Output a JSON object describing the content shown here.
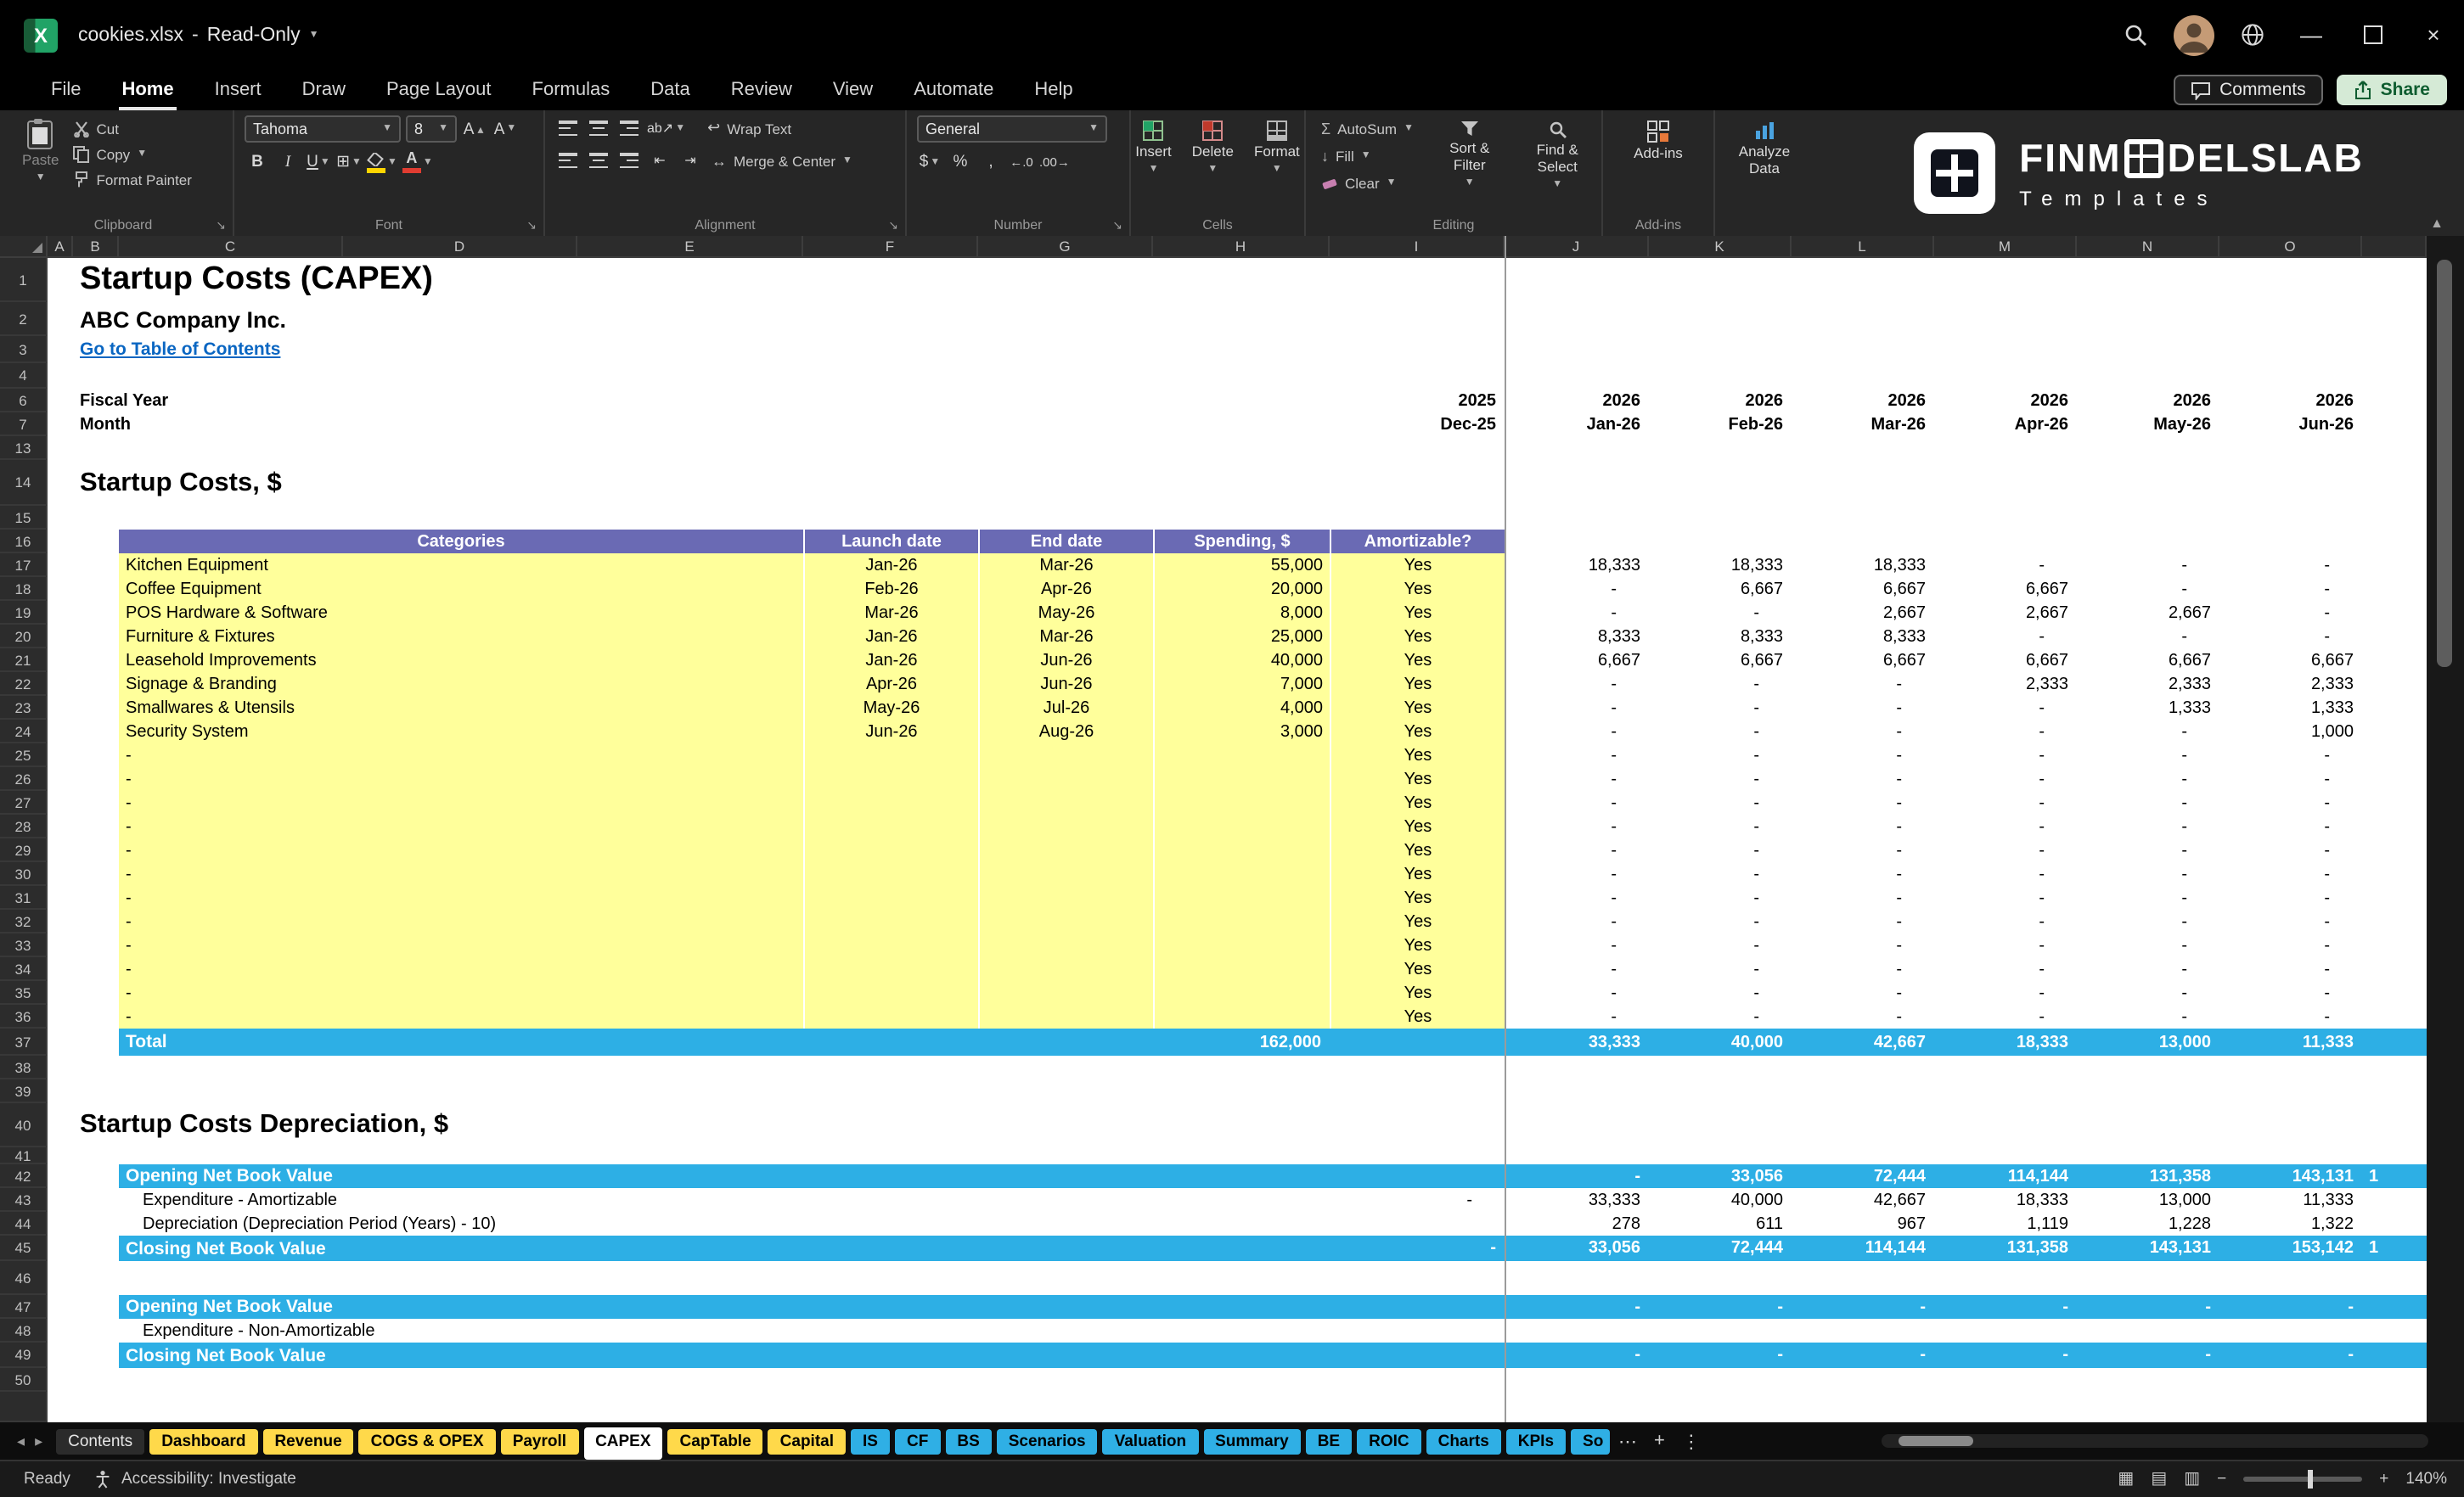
{
  "titlebar": {
    "filename": "cookies.xlsx",
    "separator": "-",
    "mode": "Read-Only"
  },
  "menu": {
    "items": [
      "File",
      "Home",
      "Insert",
      "Draw",
      "Page Layout",
      "Formulas",
      "Data",
      "Review",
      "View",
      "Automate",
      "Help"
    ],
    "active": "Home",
    "comments": "Comments",
    "share": "Share"
  },
  "ribbon": {
    "clipboard": {
      "group": "Clipboard",
      "paste": "Paste",
      "cut": "Cut",
      "copy": "Copy",
      "format_painter": "Format Painter"
    },
    "font": {
      "group": "Font",
      "family": "Tahoma",
      "size": "8"
    },
    "alignment": {
      "group": "Alignment",
      "wrap_text": "Wrap Text",
      "merge_center": "Merge & Center"
    },
    "number": {
      "group": "Number",
      "format": "General"
    },
    "cells": {
      "group": "Cells",
      "insert": "Insert",
      "delete": "Delete",
      "format": "Format"
    },
    "editing": {
      "group": "Editing",
      "autosum": "AutoSum",
      "fill": "Fill",
      "clear": "Clear",
      "sort_filter": "Sort & Filter",
      "find_select": "Find & Select"
    },
    "addins": {
      "group": "Add-ins",
      "addins": "Add-ins",
      "analyze": "Analyze Data"
    }
  },
  "brand": {
    "pre": "FINM",
    "post": "DELSLAB",
    "tagline": "Templates"
  },
  "sheet": {
    "col_letters": [
      "A",
      "B",
      "C",
      "D",
      "E",
      "F",
      "G",
      "H",
      "I",
      "J",
      "K",
      "L",
      "M",
      "N",
      "O"
    ],
    "title": "Startup Costs (CAPEX)",
    "company": "ABC Company Inc.",
    "toc": "Go to Table of Contents",
    "fiscal_year_label": "Fiscal Year",
    "month_label": "Month",
    "years": [
      "2025",
      "2026",
      "2026",
      "2026",
      "2026",
      "2026",
      "2026"
    ],
    "month_headers": [
      "Dec-25",
      "Jan-26",
      "Feb-26",
      "Mar-26",
      "Apr-26",
      "May-26",
      "Jun-26"
    ],
    "section1": "Startup Costs, $",
    "thead": {
      "categories": "Categories",
      "launch": "Launch date",
      "end": "End date",
      "spending": "Spending, $",
      "amortizable": "Amortizable?"
    },
    "items": [
      {
        "name": "Kitchen Equipment",
        "launch": "Jan-26",
        "end": "Mar-26",
        "spending": "55,000",
        "amortizable": "Yes",
        "values": [
          "18,333",
          "18,333",
          "18,333",
          "-",
          "-",
          "-"
        ]
      },
      {
        "name": "Coffee Equipment",
        "launch": "Feb-26",
        "end": "Apr-26",
        "spending": "20,000",
        "amortizable": "Yes",
        "values": [
          "-",
          "6,667",
          "6,667",
          "6,667",
          "-",
          "-"
        ]
      },
      {
        "name": "POS Hardware & Software",
        "launch": "Mar-26",
        "end": "May-26",
        "spending": "8,000",
        "amortizable": "Yes",
        "values": [
          "-",
          "-",
          "2,667",
          "2,667",
          "2,667",
          "-"
        ]
      },
      {
        "name": "Furniture & Fixtures",
        "launch": "Jan-26",
        "end": "Mar-26",
        "spending": "25,000",
        "amortizable": "Yes",
        "values": [
          "8,333",
          "8,333",
          "8,333",
          "-",
          "-",
          "-"
        ]
      },
      {
        "name": "Leasehold Improvements",
        "launch": "Jan-26",
        "end": "Jun-26",
        "spending": "40,000",
        "amortizable": "Yes",
        "values": [
          "6,667",
          "6,667",
          "6,667",
          "6,667",
          "6,667",
          "6,667"
        ]
      },
      {
        "name": "Signage & Branding",
        "launch": "Apr-26",
        "end": "Jun-26",
        "spending": "7,000",
        "amortizable": "Yes",
        "values": [
          "-",
          "-",
          "-",
          "2,333",
          "2,333",
          "2,333"
        ]
      },
      {
        "name": "Smallwares & Utensils",
        "launch": "May-26",
        "end": "Jul-26",
        "spending": "4,000",
        "amortizable": "Yes",
        "values": [
          "-",
          "-",
          "-",
          "-",
          "1,333",
          "1,333"
        ]
      },
      {
        "name": "Security System",
        "launch": "Jun-26",
        "end": "Aug-26",
        "spending": "3,000",
        "amortizable": "Yes",
        "values": [
          "-",
          "-",
          "-",
          "-",
          "-",
          "1,000"
        ]
      },
      {
        "name": "-",
        "launch": "",
        "end": "",
        "spending": "",
        "amortizable": "Yes",
        "values": [
          "-",
          "-",
          "-",
          "-",
          "-",
          "-"
        ]
      },
      {
        "name": "-",
        "launch": "",
        "end": "",
        "spending": "",
        "amortizable": "Yes",
        "values": [
          "-",
          "-",
          "-",
          "-",
          "-",
          "-"
        ]
      },
      {
        "name": "-",
        "launch": "",
        "end": "",
        "spending": "",
        "amortizable": "Yes",
        "values": [
          "-",
          "-",
          "-",
          "-",
          "-",
          "-"
        ]
      },
      {
        "name": "-",
        "launch": "",
        "end": "",
        "spending": "",
        "amortizable": "Yes",
        "values": [
          "-",
          "-",
          "-",
          "-",
          "-",
          "-"
        ]
      },
      {
        "name": "-",
        "launch": "",
        "end": "",
        "spending": "",
        "amortizable": "Yes",
        "values": [
          "-",
          "-",
          "-",
          "-",
          "-",
          "-"
        ]
      },
      {
        "name": "-",
        "launch": "",
        "end": "",
        "spending": "",
        "amortizable": "Yes",
        "values": [
          "-",
          "-",
          "-",
          "-",
          "-",
          "-"
        ]
      },
      {
        "name": "-",
        "launch": "",
        "end": "",
        "spending": "",
        "amortizable": "Yes",
        "values": [
          "-",
          "-",
          "-",
          "-",
          "-",
          "-"
        ]
      },
      {
        "name": "-",
        "launch": "",
        "end": "",
        "spending": "",
        "amortizable": "Yes",
        "values": [
          "-",
          "-",
          "-",
          "-",
          "-",
          "-"
        ]
      },
      {
        "name": "-",
        "launch": "",
        "end": "",
        "spending": "",
        "amortizable": "Yes",
        "values": [
          "-",
          "-",
          "-",
          "-",
          "-",
          "-"
        ]
      },
      {
        "name": "-",
        "launch": "",
        "end": "",
        "spending": "",
        "amortizable": "Yes",
        "values": [
          "-",
          "-",
          "-",
          "-",
          "-",
          "-"
        ]
      },
      {
        "name": "-",
        "launch": "",
        "end": "",
        "spending": "",
        "amortizable": "Yes",
        "values": [
          "-",
          "-",
          "-",
          "-",
          "-",
          "-"
        ]
      },
      {
        "name": "-",
        "launch": "",
        "end": "",
        "spending": "",
        "amortizable": "Yes",
        "values": [
          "-",
          "-",
          "-",
          "-",
          "-",
          "-"
        ]
      }
    ],
    "total": {
      "label": "Total",
      "spending": "162,000",
      "values": [
        "33,333",
        "40,000",
        "42,667",
        "18,333",
        "13,000",
        "11,333"
      ]
    },
    "section2": "Startup Costs Depreciation, $",
    "depreciation": [
      {
        "label": "Opening Net Book Value",
        "style": "band",
        "col_i": "",
        "values": [
          "-",
          "33,056",
          "72,444",
          "114,144",
          "131,358",
          "143,131"
        ],
        "overflow": "1"
      },
      {
        "label": "Expenditure - Amortizable",
        "style": "plain",
        "col_i": "-",
        "values": [
          "33,333",
          "40,000",
          "42,667",
          "18,333",
          "13,000",
          "11,333"
        ],
        "overflow": ""
      },
      {
        "label": "Depreciation (Depreciation Period (Years) - 10)",
        "style": "plain",
        "col_i": "",
        "values": [
          "278",
          "611",
          "967",
          "1,119",
          "1,228",
          "1,322"
        ],
        "overflow": ""
      },
      {
        "label": "Closing Net Book Value",
        "style": "band",
        "col_i": "-",
        "values": [
          "33,056",
          "72,444",
          "114,144",
          "131,358",
          "143,131",
          "153,142"
        ],
        "overflow": "1"
      }
    ],
    "non_amortizable": [
      {
        "label": "Opening Net Book Value",
        "style": "band",
        "col_i": "",
        "values": [
          "-",
          "-",
          "-",
          "-",
          "-",
          "-"
        ],
        "overflow": ""
      },
      {
        "label": "Expenditure - Non-Amortizable",
        "style": "plain",
        "col_i": "",
        "values": [
          "",
          "",
          "",
          "",
          "",
          ""
        ],
        "overflow": ""
      },
      {
        "label": "Closing Net Book Value",
        "style": "band",
        "col_i": "",
        "values": [
          "-",
          "-",
          "-",
          "-",
          "-",
          "-"
        ],
        "overflow": ""
      }
    ]
  },
  "tabs": {
    "items": [
      {
        "label": "Contents",
        "color": "plain"
      },
      {
        "label": "Dashboard",
        "color": "yellow"
      },
      {
        "label": "Revenue",
        "color": "yellow"
      },
      {
        "label": "COGS & OPEX",
        "color": "yellow"
      },
      {
        "label": "Payroll",
        "color": "yellow"
      },
      {
        "label": "CAPEX",
        "color": "active"
      },
      {
        "label": "CapTable",
        "color": "yellow"
      },
      {
        "label": "Capital",
        "color": "yellow"
      },
      {
        "label": "IS",
        "color": "blue"
      },
      {
        "label": "CF",
        "color": "blue"
      },
      {
        "label": "BS",
        "color": "blue"
      },
      {
        "label": "Scenarios",
        "color": "blue"
      },
      {
        "label": "Valuation",
        "color": "blue"
      },
      {
        "label": "Summary",
        "color": "blue"
      },
      {
        "label": "BE",
        "color": "blue"
      },
      {
        "label": "ROIC",
        "color": "blue"
      },
      {
        "label": "Charts",
        "color": "blue"
      },
      {
        "label": "KPIs",
        "color": "blue"
      },
      {
        "label": "So",
        "color": "blue",
        "clipped": true
      }
    ]
  },
  "status": {
    "ready": "Ready",
    "accessibility": "Accessibility: Investigate",
    "zoom": "140%"
  },
  "colors": {
    "header_purple": "#6a6ab4",
    "row_yellow": "#ffff9b",
    "band_blue": "#2dafe5",
    "tab_yellow": "#ffd94a",
    "tab_blue": "#2fafe5",
    "link_blue": "#0a66c2",
    "excel_green": "#21a366"
  }
}
